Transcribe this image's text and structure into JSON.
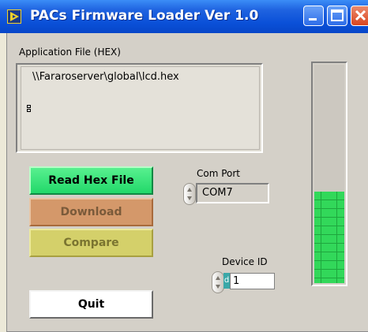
{
  "window": {
    "title": "PACs Firmware Loader Ver 1.0"
  },
  "application_file": {
    "label": "Application File (HEX)",
    "path": "\\\\Fararoserver\\global\\lcd.hex"
  },
  "buttons": {
    "read_hex_file": "Read Hex File",
    "download": "Download",
    "compare": "Compare",
    "quit": "Quit"
  },
  "com_port": {
    "label": "Com Port",
    "value": "COM7"
  },
  "device_id": {
    "label": "Device ID",
    "radix": "d",
    "value": "1"
  },
  "progress": {
    "fraction": 0.42,
    "fill_color": "#32d85a"
  },
  "colors": {
    "read_button": "#22d86a",
    "download_button": "#d4986a",
    "compare_button": "#d4d06a",
    "quit_button": "#ffffff"
  }
}
